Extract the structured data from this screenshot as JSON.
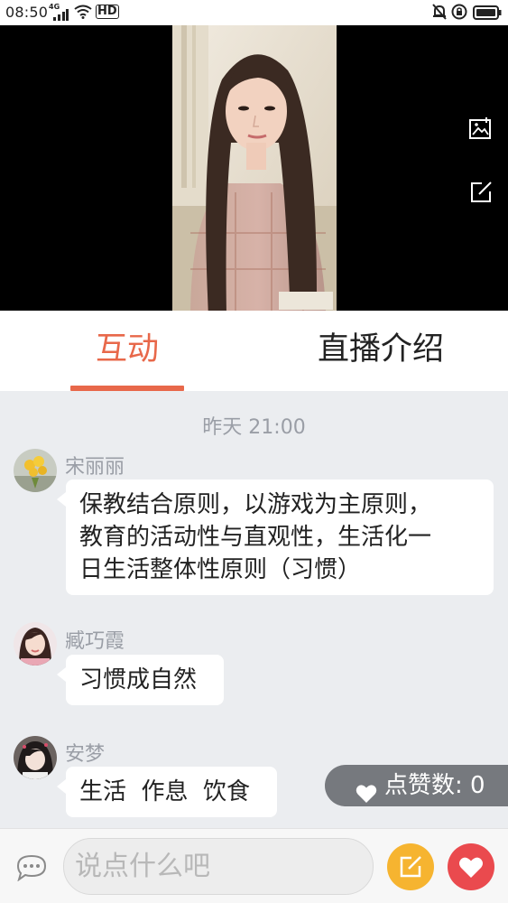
{
  "status_bar": {
    "time": "08:50",
    "network": "4G",
    "hd": "HD"
  },
  "tabs": [
    {
      "label": "互动",
      "active": true
    },
    {
      "label": "直播介绍",
      "active": false
    }
  ],
  "chat": {
    "date_separator": "昨天 21:00",
    "messages": [
      {
        "user": "宋丽丽",
        "text_lines": [
          "保教结合原则，以游戏为主原则，",
          "教育的活动性与直观性，生活化一",
          "日生活整体性原则（习惯）"
        ]
      },
      {
        "user": "臧巧霞",
        "text_lines": [
          "习惯成自然"
        ]
      },
      {
        "user": "安梦",
        "text_lines": [
          "生活  作息  饮食"
        ]
      }
    ]
  },
  "likes": {
    "label": "点赞数: 0"
  },
  "input": {
    "placeholder": "说点什么吧"
  },
  "colors": {
    "accent": "#e8684a",
    "edit_button": "#f6b430",
    "heart_button": "#ea4a4e",
    "chat_background": "#ebedf0"
  }
}
